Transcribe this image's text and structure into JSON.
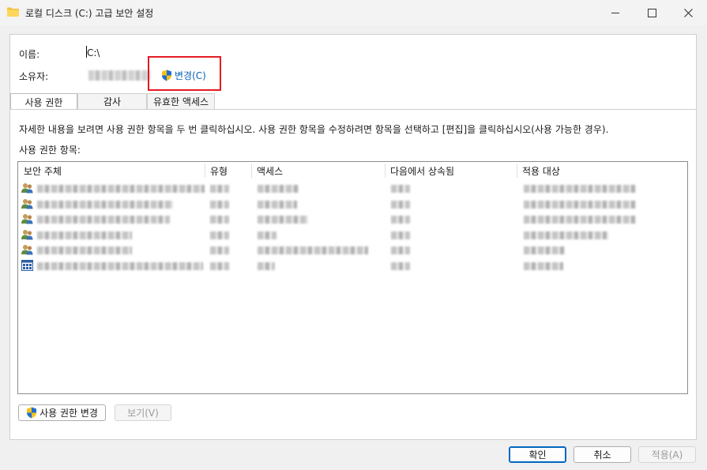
{
  "window": {
    "title": "로컬 디스크 (C:) 고급 보안 설정",
    "folder_icon": "folder-icon",
    "controls": [
      "minimize-icon",
      "maximize-icon",
      "close-icon"
    ]
  },
  "info": {
    "name_label": "이름:",
    "name_value": "C:\\",
    "owner_label": "소유자:",
    "change_label": "변경(C)",
    "highlight_color": "#e41b23"
  },
  "tabs": [
    {
      "label": "사용 권한",
      "active": true
    },
    {
      "label": "감사",
      "active": false
    },
    {
      "label": "유효한 액세스",
      "active": false
    }
  ],
  "description": "자세한 내용을 보려면 사용 권한 항목을 두 번 클릭하십시오. 사용 권한 항목을 수정하려면 항목을 선택하고 [편집]을 클릭하십시오(사용 가능한 경우).",
  "entries_label": "사용 권한 항목:",
  "columns": [
    "보안 주체",
    "유형",
    "액세스",
    "다음에서 상속됨",
    "적용 대상"
  ],
  "rows": [
    {
      "icon": "users-icon"
    },
    {
      "icon": "users-icon"
    },
    {
      "icon": "users-icon"
    },
    {
      "icon": "users-icon"
    },
    {
      "icon": "users-icon"
    },
    {
      "icon": "package-icon"
    }
  ],
  "buttons": {
    "change_permissions": "사용 권한 변경",
    "view": "보기(V)",
    "ok": "확인",
    "cancel": "취소",
    "apply": "적용(A)"
  },
  "colors": {
    "link": "#0a5fb4",
    "accent": "#0067c0"
  }
}
